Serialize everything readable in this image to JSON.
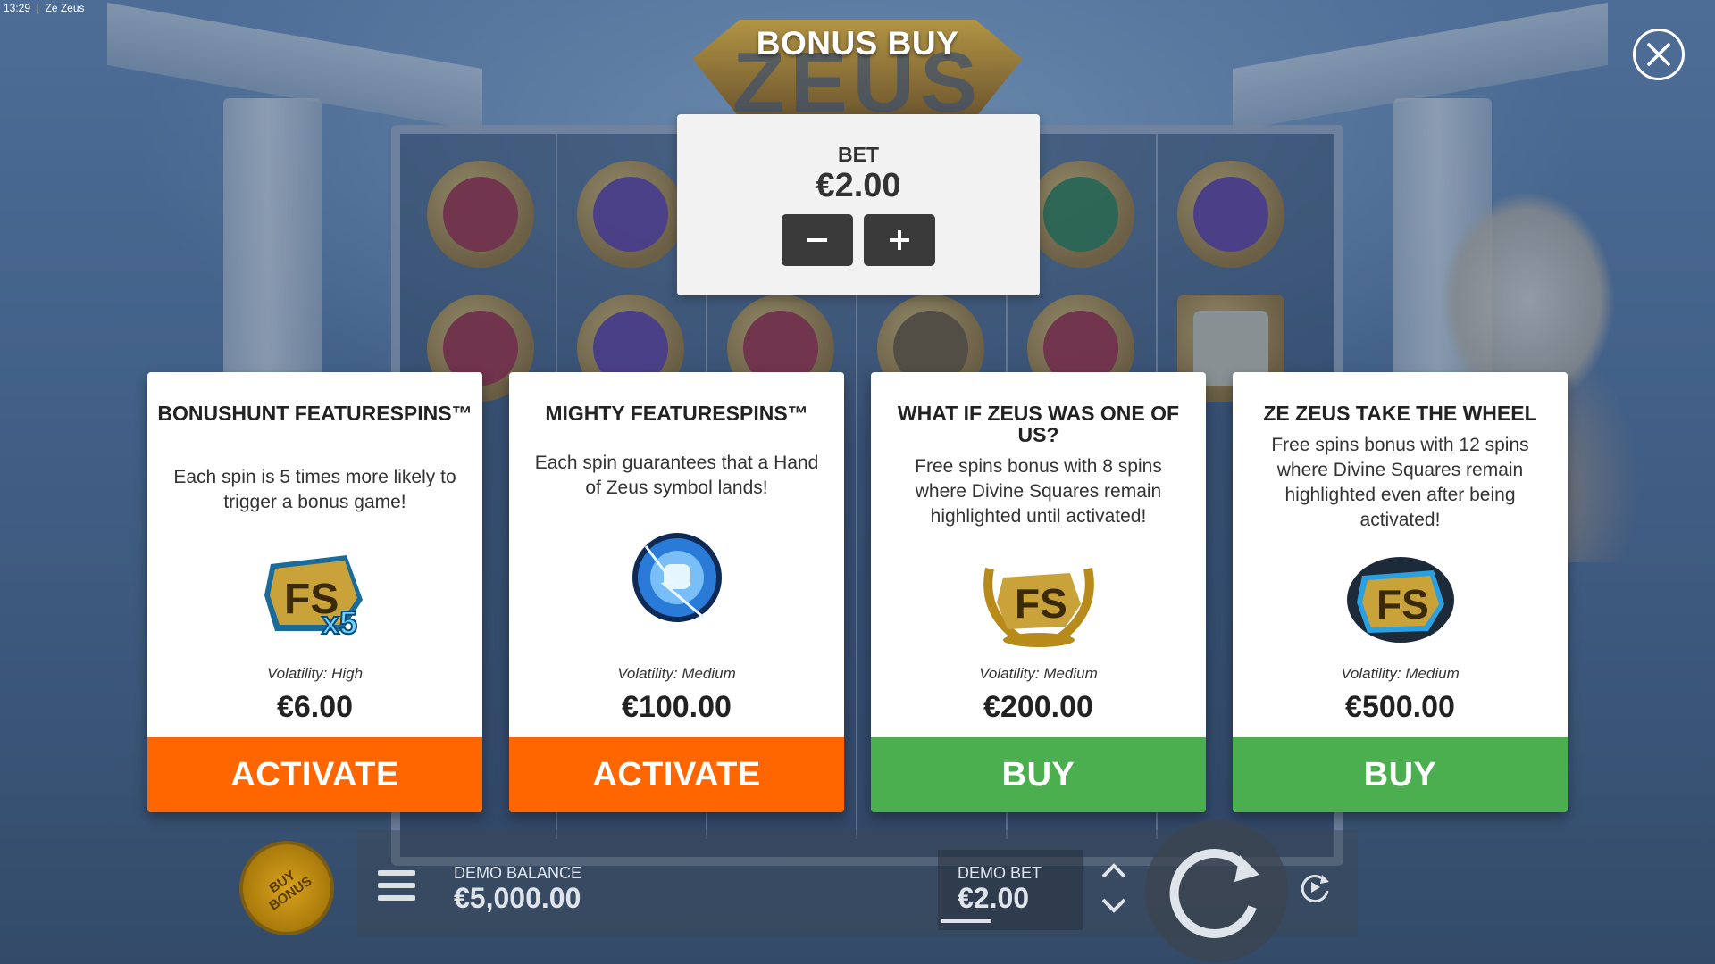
{
  "window": {
    "time": "13:29",
    "title": "Ze Zeus"
  },
  "logo_text": "ZEUS",
  "modal": {
    "title": "BONUS BUY",
    "bet": {
      "label": "BET",
      "value": "€2.00"
    }
  },
  "cards": [
    {
      "title": "BONUSHUNT FEATURESPINS™",
      "description": "Each spin is 5 times more likely to trigger a bonus game!",
      "icon": "fs-x5-icon",
      "volatility": "Volatility: High",
      "price": "€6.00",
      "action": "ACTIVATE",
      "action_color": "#ff6600"
    },
    {
      "title": "MIGHTY FEATURESPINS™",
      "description": "Each spin guarantees that a Hand of Zeus symbol lands!",
      "icon": "hand-of-zeus-icon",
      "volatility": "Volatility: Medium",
      "price": "€100.00",
      "action": "ACTIVATE",
      "action_color": "#ff6600"
    },
    {
      "title": "WHAT IF ZEUS WAS ONE OF US?",
      "description": "Free spins bonus with 8 spins where Divine Squares remain highlighted until activated!",
      "icon": "fs-laurel-icon",
      "volatility": "Volatility: Medium",
      "price": "€200.00",
      "action": "BUY",
      "action_color": "#4caf4f"
    },
    {
      "title": "ZE ZEUS TAKE THE WHEEL",
      "description": "Free spins bonus with 12 spins where Divine Squares remain highlighted even after being activated!",
      "icon": "fs-lightning-icon",
      "volatility": "Volatility: Medium",
      "price": "€500.00",
      "action": "BUY",
      "action_color": "#4caf4f"
    }
  ],
  "bottom_bar": {
    "buy_bonus_label": "BUY BONUS",
    "demo_balance_label": "DEMO BALANCE",
    "demo_balance_value": "€5,000.00",
    "demo_bet_label": "DEMO BET",
    "demo_bet_value": "€2.00"
  }
}
